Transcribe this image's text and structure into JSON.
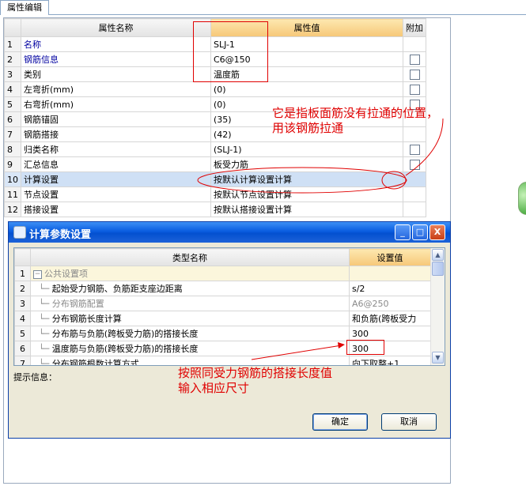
{
  "tab": {
    "label": "属性编辑"
  },
  "grid": {
    "headers": {
      "name": "属性名称",
      "value": "属性值",
      "extra": "附加"
    },
    "rows": [
      {
        "n": "1",
        "name": "名称",
        "value": "SLJ-1",
        "check": false,
        "blue": true
      },
      {
        "n": "2",
        "name": "钢筋信息",
        "value": "C6@150",
        "check": true,
        "blue": true
      },
      {
        "n": "3",
        "name": "类别",
        "value": "温度筋",
        "check": true,
        "blue": false
      },
      {
        "n": "4",
        "name": "左弯折(mm)",
        "value": "(0)",
        "check": true,
        "blue": false
      },
      {
        "n": "5",
        "name": "右弯折(mm)",
        "value": "(0)",
        "check": true,
        "blue": false
      },
      {
        "n": "6",
        "name": "钢筋锚固",
        "value": "(35)",
        "check": false,
        "blue": false
      },
      {
        "n": "7",
        "name": "钢筋搭接",
        "value": "(42)",
        "check": false,
        "blue": false
      },
      {
        "n": "8",
        "name": "归类名称",
        "value": "(SLJ-1)",
        "check": true,
        "blue": false
      },
      {
        "n": "9",
        "name": "汇总信息",
        "value": "板受力筋",
        "check": true,
        "blue": false
      },
      {
        "n": "10",
        "name": "计算设置",
        "value": "按默认计算设置计算",
        "check": false,
        "blue": false
      },
      {
        "n": "11",
        "name": "节点设置",
        "value": "按默认节点设置计算",
        "check": false,
        "blue": false
      },
      {
        "n": "12",
        "name": "搭接设置",
        "value": "按默认搭接设置计算",
        "check": false,
        "blue": false
      }
    ]
  },
  "annotation_top": {
    "line1": "它是指板面筋没有拉通的位置，",
    "line2": "用该钢筋拉通"
  },
  "dialog": {
    "title": "计算参数设置",
    "headers": {
      "name": "类型名称",
      "value": "设置值"
    },
    "rows": [
      {
        "n": "1",
        "name": "公共设置项",
        "value": "",
        "group": true,
        "grey": true
      },
      {
        "n": "2",
        "name": "起始受力钢筋、负筋距支座边距离",
        "value": "s/2",
        "grey": false
      },
      {
        "n": "3",
        "name": "分布钢筋配置",
        "value": "A6@250",
        "grey": true
      },
      {
        "n": "4",
        "name": "分布钢筋长度计算",
        "value": "和负筋(跨板受力",
        "grey": false
      },
      {
        "n": "5",
        "name": "分布筋与负筋(跨板受力筋)的搭接长度",
        "value": "300",
        "grey": false
      },
      {
        "n": "6",
        "name": "温度筋与负筋(跨板受力筋)的搭接长度",
        "value": "300",
        "grey": false
      },
      {
        "n": "7",
        "name": "分布钢筋根数计算方式",
        "value": "向下取整+1",
        "grey": false
      }
    ],
    "hint_label": "提示信息：",
    "ok": "确定",
    "cancel": "取消",
    "minimize": "_",
    "maximize": "□",
    "close": "X"
  },
  "annotation_bottom": {
    "line1": "按照同受力钢筋的搭接长度值",
    "line2": "输入相应尺寸"
  },
  "colors": {
    "annotation": "#e00000",
    "title_bar": "#0a5de0",
    "header_highlight": "#f6c778"
  }
}
